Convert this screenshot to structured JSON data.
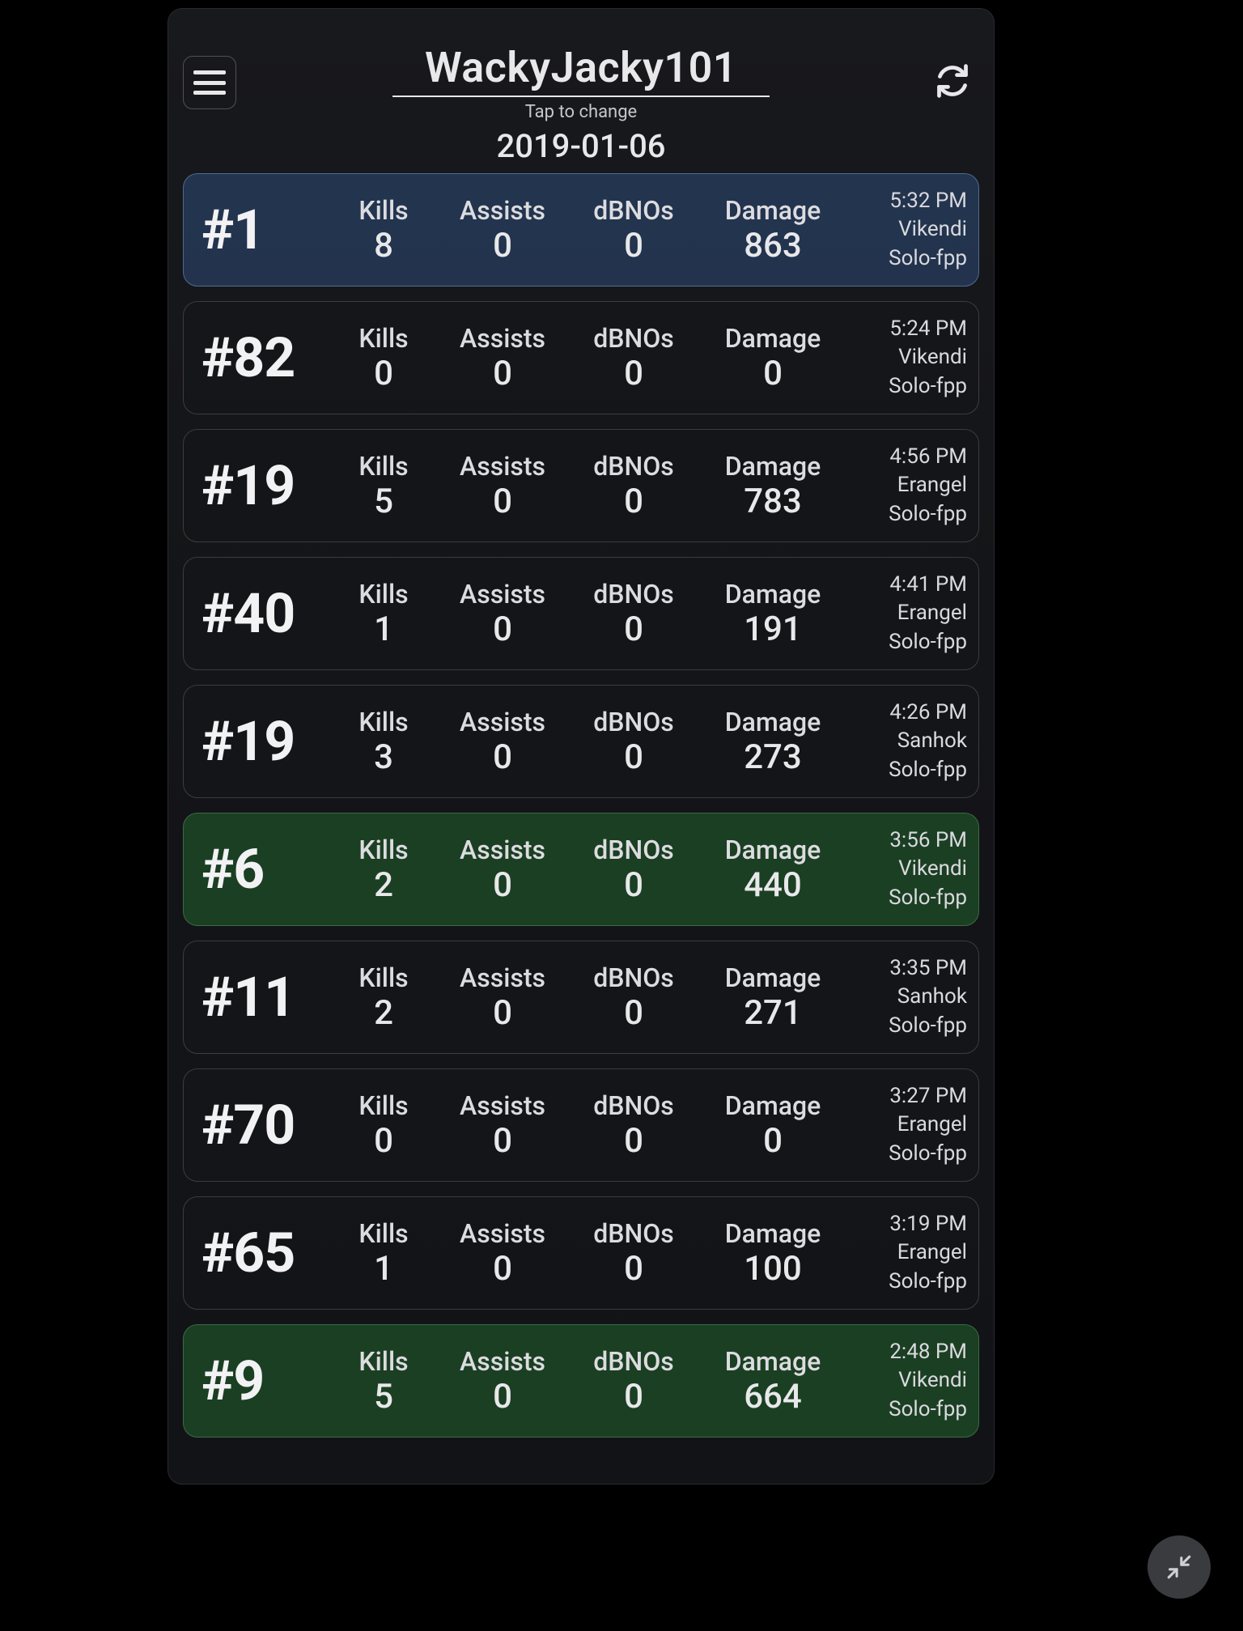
{
  "header": {
    "player_name": "WackyJacky101",
    "tap_hint": "Tap to change",
    "date": "2019-01-06"
  },
  "stat_labels": {
    "kills": "Kills",
    "assists": "Assists",
    "dbnos": "dBNOs",
    "damage": "Damage"
  },
  "matches": [
    {
      "rank": "#1",
      "kills": "8",
      "assists": "0",
      "dbnos": "0",
      "damage": "863",
      "time": "5:32 PM",
      "map": "Vikendi",
      "mode": "Solo-fpp",
      "style": "win"
    },
    {
      "rank": "#82",
      "kills": "0",
      "assists": "0",
      "dbnos": "0",
      "damage": "0",
      "time": "5:24 PM",
      "map": "Vikendi",
      "mode": "Solo-fpp",
      "style": "normal"
    },
    {
      "rank": "#19",
      "kills": "5",
      "assists": "0",
      "dbnos": "0",
      "damage": "783",
      "time": "4:56 PM",
      "map": "Erangel",
      "mode": "Solo-fpp",
      "style": "normal"
    },
    {
      "rank": "#40",
      "kills": "1",
      "assists": "0",
      "dbnos": "0",
      "damage": "191",
      "time": "4:41 PM",
      "map": "Erangel",
      "mode": "Solo-fpp",
      "style": "normal"
    },
    {
      "rank": "#19",
      "kills": "3",
      "assists": "0",
      "dbnos": "0",
      "damage": "273",
      "time": "4:26 PM",
      "map": "Sanhok",
      "mode": "Solo-fpp",
      "style": "normal"
    },
    {
      "rank": "#6",
      "kills": "2",
      "assists": "0",
      "dbnos": "0",
      "damage": "440",
      "time": "3:56 PM",
      "map": "Vikendi",
      "mode": "Solo-fpp",
      "style": "top10"
    },
    {
      "rank": "#11",
      "kills": "2",
      "assists": "0",
      "dbnos": "0",
      "damage": "271",
      "time": "3:35 PM",
      "map": "Sanhok",
      "mode": "Solo-fpp",
      "style": "normal"
    },
    {
      "rank": "#70",
      "kills": "0",
      "assists": "0",
      "dbnos": "0",
      "damage": "0",
      "time": "3:27 PM",
      "map": "Erangel",
      "mode": "Solo-fpp",
      "style": "normal"
    },
    {
      "rank": "#65",
      "kills": "1",
      "assists": "0",
      "dbnos": "0",
      "damage": "100",
      "time": "3:19 PM",
      "map": "Erangel",
      "mode": "Solo-fpp",
      "style": "normal"
    },
    {
      "rank": "#9",
      "kills": "5",
      "assists": "0",
      "dbnos": "0",
      "damage": "664",
      "time": "2:48 PM",
      "map": "Vikendi",
      "mode": "Solo-fpp",
      "style": "top10"
    }
  ]
}
